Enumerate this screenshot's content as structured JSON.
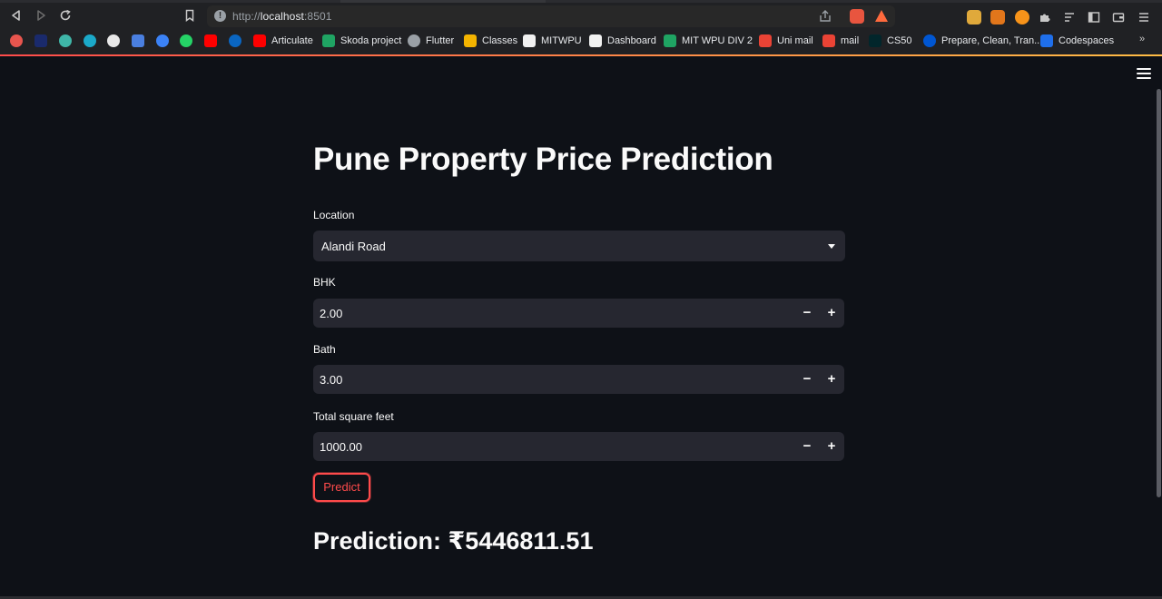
{
  "browser": {
    "url_prefix": "http://",
    "url_host": "localhost",
    "url_port": ":8501",
    "bookmarks": [
      {
        "label": "",
        "icon": "favicon-1",
        "color": "#e8554e"
      },
      {
        "label": "",
        "icon": "favicon-bh",
        "color": "#1a2a6c"
      },
      {
        "label": "",
        "icon": "favicon-3",
        "color": "#3fb6a8"
      },
      {
        "label": "",
        "icon": "favicon-play",
        "color": "#1ba9c9"
      },
      {
        "label": "",
        "icon": "favicon-5",
        "color": "#e8e8e8"
      },
      {
        "label": "",
        "icon": "favicon-6",
        "color": "#4a7fe0"
      },
      {
        "label": "",
        "icon": "favicon-7",
        "color": "#3b82f6"
      },
      {
        "label": "",
        "icon": "whatsapp-icon",
        "color": "#25d366"
      },
      {
        "label": "",
        "icon": "youtube-icon",
        "color": "#ff0000"
      },
      {
        "label": "",
        "icon": "favicon-c",
        "color": "#0a66c2"
      },
      {
        "label": "Articulate",
        "icon": "youtube-icon",
        "color": "#ff0000"
      },
      {
        "label": "Skoda project",
        "icon": "google-drive-icon",
        "color": "#1fa463"
      },
      {
        "label": "Flutter",
        "icon": "globe-icon",
        "color": "#9aa0a6"
      },
      {
        "label": "Classes",
        "icon": "google-classroom-icon",
        "color": "#f4b400"
      },
      {
        "label": "MITWPU",
        "icon": "favicon-mit",
        "color": "#f1f1f1"
      },
      {
        "label": "Dashboard",
        "icon": "favicon-dashboard",
        "color": "#f1f1f1"
      },
      {
        "label": "MIT WPU DIV 2",
        "icon": "google-drive-icon",
        "color": "#1fa463"
      },
      {
        "label": "Uni mail",
        "icon": "gmail-icon",
        "color": "#ea4335"
      },
      {
        "label": "mail",
        "icon": "gmail-icon",
        "color": "#ea4335"
      },
      {
        "label": "CS50",
        "icon": "edx-icon",
        "color": "#02262b"
      },
      {
        "label": "Prepare, Clean, Tran...",
        "icon": "coursera-icon",
        "color": "#0056d2"
      },
      {
        "label": "Codespaces",
        "icon": "codespaces-icon",
        "color": "#1f6feb"
      }
    ]
  },
  "app": {
    "title": "Pune Property Price Prediction",
    "location": {
      "label": "Location",
      "value": "Alandi Road"
    },
    "bhk": {
      "label": "BHK",
      "value": "2.00"
    },
    "bath": {
      "label": "Bath",
      "value": "3.00"
    },
    "sqft": {
      "label": "Total square feet",
      "value": "1000.00"
    },
    "stepper": {
      "minus": "−",
      "plus": "+"
    },
    "predict_label": "Predict",
    "result_text": "Prediction: ₹5446811.51"
  },
  "colors": {
    "background": "#0e1117",
    "input_bg": "#262730",
    "accent": "#ff4b4b"
  }
}
